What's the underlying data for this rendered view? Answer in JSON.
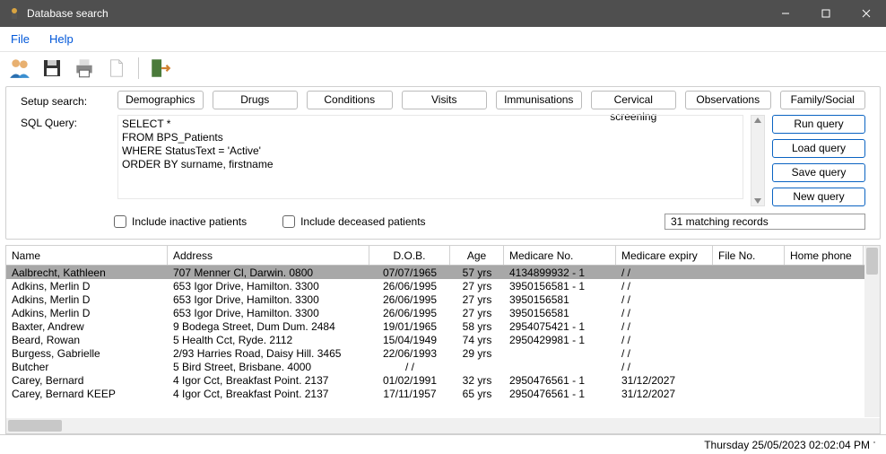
{
  "window": {
    "title": "Database search"
  },
  "menu": {
    "file": "File",
    "help": "Help"
  },
  "labels": {
    "setup_search": "Setup search:",
    "sql_query": "SQL Query:",
    "matching": "31 matching records"
  },
  "setup_buttons": {
    "demographics": "Demographics",
    "drugs": "Drugs",
    "conditions": "Conditions",
    "visits": "Visits",
    "immunisations": "Immunisations",
    "cervical": "Cervical screening",
    "observations": "Observations",
    "family": "Family/Social"
  },
  "sql_text": "SELECT *\nFROM BPS_Patients\nWHERE StatusText = 'Active'\nORDER BY surname, firstname",
  "query_buttons": {
    "run": "Run query",
    "load": "Load query",
    "save": "Save query",
    "new": "New query"
  },
  "checkboxes": {
    "inactive": "Include inactive patients",
    "deceased": "Include deceased patients"
  },
  "columns": {
    "name": "Name",
    "address": "Address",
    "dob": "D.O.B.",
    "age": "Age",
    "medicare": "Medicare No.",
    "expiry": "Medicare expiry",
    "file": "File No.",
    "phone": "Home phone"
  },
  "rows": [
    {
      "name": "Aalbrecht, Kathleen",
      "addr": "707 Menner Cl, Darwin. 0800",
      "dob": "07/07/1965",
      "age": "57 yrs",
      "med": "4134899932 - 1",
      "exp": "/ /",
      "file": "",
      "phone": ""
    },
    {
      "name": "Adkins, Merlin D",
      "addr": "653 Igor Drive, Hamilton. 3300",
      "dob": "26/06/1995",
      "age": "27 yrs",
      "med": "3950156581 - 1",
      "exp": "/ /",
      "file": "",
      "phone": ""
    },
    {
      "name": "Adkins, Merlin D",
      "addr": "653 Igor Drive, Hamilton. 3300",
      "dob": "26/06/1995",
      "age": "27 yrs",
      "med": "3950156581",
      "exp": "/ /",
      "file": "",
      "phone": ""
    },
    {
      "name": "Adkins, Merlin D",
      "addr": "653 Igor Drive, Hamilton. 3300",
      "dob": "26/06/1995",
      "age": "27 yrs",
      "med": "3950156581",
      "exp": "/ /",
      "file": "",
      "phone": ""
    },
    {
      "name": "Baxter, Andrew",
      "addr": "9 Bodega Street, Dum Dum. 2484",
      "dob": "19/01/1965",
      "age": "58 yrs",
      "med": "2954075421 - 1",
      "exp": "/ /",
      "file": "",
      "phone": ""
    },
    {
      "name": "Beard, Rowan",
      "addr": "5 Health Cct, Ryde. 2112",
      "dob": "15/04/1949",
      "age": "74 yrs",
      "med": "2950429981 - 1",
      "exp": "/ /",
      "file": "",
      "phone": ""
    },
    {
      "name": "Burgess, Gabrielle",
      "addr": "2/93 Harries Road, Daisy Hill. 3465",
      "dob": "22/06/1993",
      "age": "29 yrs",
      "med": "",
      "exp": "/ /",
      "file": "",
      "phone": ""
    },
    {
      "name": "Butcher",
      "addr": "5 Bird Street, Brisbane. 4000",
      "dob": "/ /",
      "age": "",
      "med": "",
      "exp": "/ /",
      "file": "",
      "phone": ""
    },
    {
      "name": "Carey, Bernard",
      "addr": "4 Igor Cct, Breakfast Point. 2137",
      "dob": "01/02/1991",
      "age": "32 yrs",
      "med": "2950476561 - 1",
      "exp": "31/12/2027",
      "file": "",
      "phone": ""
    },
    {
      "name": "Carey, Bernard KEEP",
      "addr": "4 Igor Cct, Breakfast Point. 2137",
      "dob": "17/11/1957",
      "age": "65 yrs",
      "med": "2950476561 - 1",
      "exp": "31/12/2027",
      "file": "",
      "phone": ""
    }
  ],
  "status": {
    "datetime": "Thursday 25/05/2023 02:02:04 PM"
  },
  "icons": {
    "users": "users-icon",
    "save": "floppy-icon",
    "print": "printer-icon",
    "doc": "document-icon",
    "exit": "exit-icon"
  }
}
